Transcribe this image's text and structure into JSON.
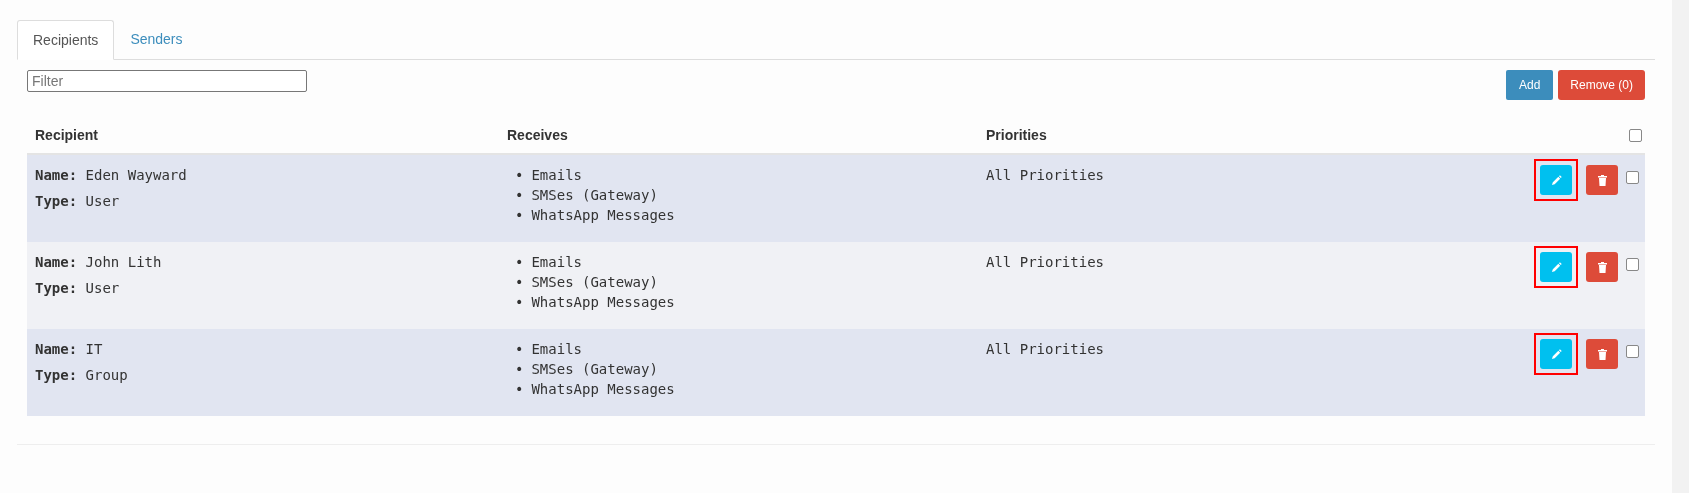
{
  "tabs": [
    {
      "label": "Recipients",
      "selected": true
    },
    {
      "label": "Senders",
      "selected": false
    }
  ],
  "filter": {
    "placeholder": "Filter"
  },
  "list_marker": "•",
  "buttons": {
    "add": "Add",
    "remove": "Remove (0)"
  },
  "table": {
    "columns": [
      "Recipient",
      "Receives",
      "Priorities"
    ],
    "select_all": {
      "checked": false
    },
    "rows": [
      {
        "name_label": "Name:",
        "name": "Eden Wayward",
        "type_label": "Type:",
        "type": "User",
        "receives": [
          "Emails",
          "SMSes (Gateway)",
          "WhatsApp Messages"
        ],
        "priorities": "All Priorities",
        "edit_highlighted": true,
        "checked": false
      },
      {
        "name_label": "Name:",
        "name": "John Lith",
        "type_label": "Type:",
        "type": "User",
        "receives": [
          "Emails",
          "SMSes (Gateway)",
          "WhatsApp Messages"
        ],
        "priorities": "All Priorities",
        "edit_highlighted": true,
        "checked": false
      },
      {
        "name_label": "Name:",
        "name": "IT",
        "type_label": "Type:",
        "type": "Group",
        "receives": [
          "Emails",
          "SMSes (Gateway)",
          "WhatsApp Messages"
        ],
        "priorities": "All Priorities",
        "edit_highlighted": true,
        "checked": false
      }
    ]
  }
}
